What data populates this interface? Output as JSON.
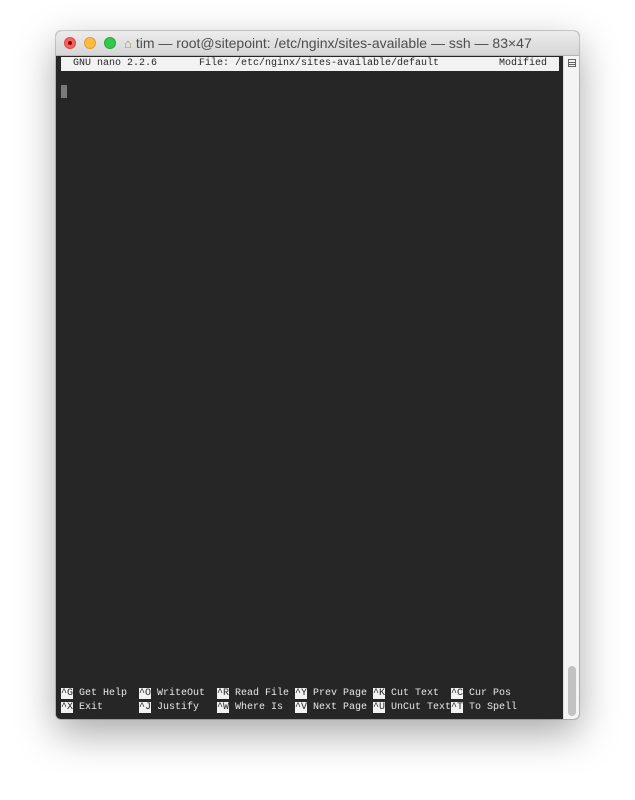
{
  "window": {
    "title": "tim — root@sitepoint: /etc/nginx/sites-available — ssh — 83×47",
    "home_icon": "home-icon"
  },
  "nano": {
    "version": "GNU nano 2.2.6",
    "file": "File: /etc/nginx/sites-available/default",
    "status": "Modified"
  },
  "shortcuts": [
    [
      {
        "key": "^G",
        "label": "Get Help"
      },
      {
        "key": "^O",
        "label": "WriteOut"
      },
      {
        "key": "^R",
        "label": "Read File"
      },
      {
        "key": "^Y",
        "label": "Prev Page"
      },
      {
        "key": "^K",
        "label": "Cut Text"
      },
      {
        "key": "^C",
        "label": "Cur Pos"
      }
    ],
    [
      {
        "key": "^X",
        "label": "Exit"
      },
      {
        "key": "^J",
        "label": "Justify"
      },
      {
        "key": "^W",
        "label": "Where Is"
      },
      {
        "key": "^V",
        "label": "Next Page"
      },
      {
        "key": "^U",
        "label": "UnCut Text"
      },
      {
        "key": "^T",
        "label": "To Spell"
      }
    ]
  ],
  "scrollbar": {
    "position_percent": 100
  }
}
